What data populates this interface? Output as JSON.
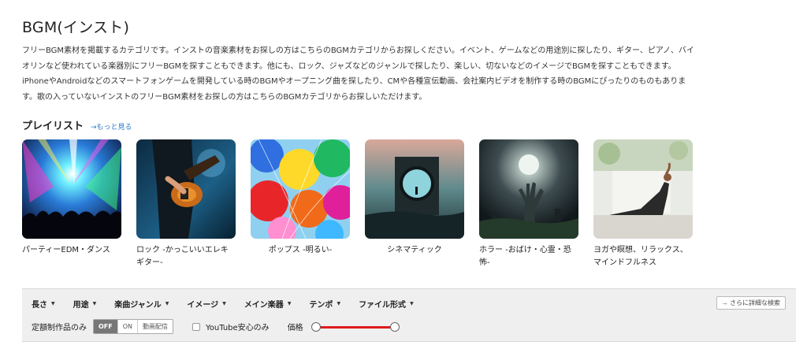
{
  "page": {
    "title": "BGM(インスト)",
    "description": "フリーBGM素材を掲載するカテゴリです。インストの音楽素材をお探しの方はこちらのBGMカテゴリからお探しください。イベント、ゲームなどの用途別に探したり、ギター、ピアノ、バイオリンなど使われている楽器別にフリーBGMを探すこともできます。他にも、ロック、ジャズなどのジャンルで探したり、楽しい、切ないなどのイメージでBGMを探すこともできます。iPhoneやAndroidなどのスマートフォンゲームを開発している時のBGMやオープニング曲を探したり、CMや各種宣伝動画、会社案内ビデオを制作する時のBGMにぴったりのものもあります。歌の入っていないインストのフリーBGM素材をお探しの方はこちらのBGMカテゴリからお探しいただけます。"
  },
  "playlist": {
    "title": "プレイリスト",
    "more_link": "→もっと見る",
    "items": [
      {
        "label": "パーティーEDM・ダンス",
        "image": "party-crowd-lights-image"
      },
      {
        "label": "ロック -かっこいいエレキギター-",
        "image": "electric-guitar-player-image"
      },
      {
        "label": "ポップス -明るい-",
        "image": "colorful-balloons-image"
      },
      {
        "label": "シネマティック",
        "image": "cinematic-portal-image"
      },
      {
        "label": "ホラー -おばけ・心霊・恐怖-",
        "image": "zombie-hand-graveyard-image"
      },
      {
        "label": "ヨガや瞑想、リラックス、マインドフルネス",
        "image": "yoga-pose-image"
      }
    ]
  },
  "filters": {
    "items": [
      "長さ",
      "用途",
      "楽曲ジャンル",
      "イメージ",
      "メイン楽器",
      "テンポ",
      "ファイル形式"
    ],
    "detail_button": "→ さらに詳細な検索",
    "subscription_label": "定額制作品のみ",
    "toggle": [
      "OFF",
      "ON",
      "動画配信"
    ],
    "toggle_selected": "OFF",
    "youtube_label": "YouTube安心のみ",
    "youtube_checked": false,
    "price_label": "価格",
    "price_range": [
      0,
      1
    ]
  },
  "colors": {
    "link": "#2979c9",
    "slider_track": "#e01b1b",
    "toggle_active": "#777777"
  }
}
